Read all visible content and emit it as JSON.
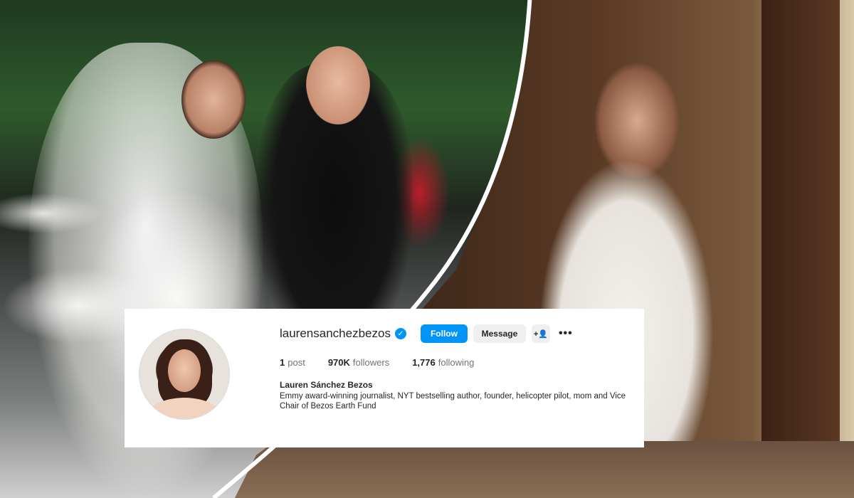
{
  "profile": {
    "handle": "laurensanchezbezos",
    "verified_glyph": "✓",
    "follow_label": "Follow",
    "message_label": "Message",
    "add_user_glyph": "+👤",
    "more_glyph": "•••",
    "stats": {
      "posts_value": "1",
      "posts_label": "post",
      "followers_value": "970K",
      "followers_label": "followers",
      "following_value": "1,776",
      "following_label": "following"
    },
    "name": "Lauren Sánchez Bezos",
    "bio": "Emmy award-winning journalist, NYT bestselling author, founder, helicopter pilot, mom and Vice Chair of Bezos Earth Fund"
  },
  "colors": {
    "follow_button": "#0095f6",
    "verified_badge": "#0095f6",
    "secondary_button": "#efefef",
    "card_background": "#ffffff"
  },
  "icons": [
    "verified-badge-icon",
    "add-user-icon",
    "more-options-icon"
  ]
}
